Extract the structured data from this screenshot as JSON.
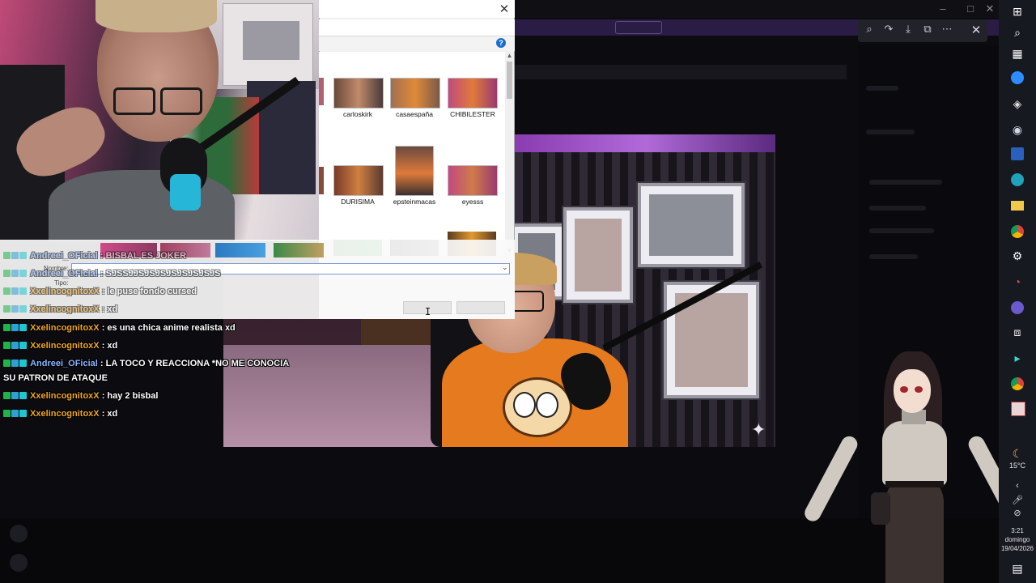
{
  "dialog": {
    "files": [
      {
        "name": ""
      },
      {
        "name": "carloskirk"
      },
      {
        "name": "casaespaña"
      },
      {
        "name": "CHIBILESTER"
      },
      {
        "name": ""
      },
      {
        "name": "DURISIMA"
      },
      {
        "name": "epsteinmacas"
      },
      {
        "name": "eyesss"
      }
    ],
    "name_label": "Nombre:",
    "type_label": "Tipo:",
    "name_value": "",
    "open_label": "",
    "cancel_label": ""
  },
  "chat": {
    "messages": [
      {
        "user": "Andreei_OFicial",
        "user_color": "#8ab4ff",
        "text": ": BISBAL ES JOKER",
        "badges": [
          "green",
          "blue",
          "cyan"
        ]
      },
      {
        "user": "Andreei_OFicial",
        "user_color": "#8ab4ff",
        "text": ": SJSSJJSJSJSJSJSJSJSJS",
        "badges": [
          "green",
          "blue",
          "cyan"
        ]
      },
      {
        "user": "XxelincognitoxX",
        "user_color": "#f0a61e",
        "text": ": le puse fondo cursed",
        "badges": [
          "green",
          "blue",
          "cyan"
        ]
      },
      {
        "user": "XxelincognitoxX",
        "user_color": "#f0a61e",
        "text": ": xd",
        "badges": [
          "green",
          "blue",
          "cyan"
        ]
      },
      {
        "user": "XxelincognitoxX",
        "user_color": "#f0a61e",
        "text": ": es una chica anime realista xd",
        "badges": [
          "green",
          "blue",
          "cyan"
        ]
      },
      {
        "user": "XxelincognitoxX",
        "user_color": "#f0a61e",
        "text": ": xd",
        "badges": [
          "green",
          "blue",
          "cyan"
        ]
      },
      {
        "user": "Andreei_OFicial",
        "user_color": "#8ab4ff",
        "text": ": LA TOCO Y REACCIONA *NO ME CONOCIA",
        "badges": [
          "green",
          "blue",
          "cyan"
        ]
      },
      {
        "user": "",
        "user_color": "#ffffff",
        "text": "SU PATRON DE ATAQUE",
        "badges": []
      },
      {
        "user": "XxelincognitoxX",
        "user_color": "#f0a61e",
        "text": ": hay 2 bisbal",
        "badges": [
          "green",
          "blue",
          "cyan"
        ]
      },
      {
        "user": "XxelincognitoxX",
        "user_color": "#f0a61e",
        "text": ": xd",
        "badges": [
          "green",
          "blue",
          "cyan"
        ]
      }
    ]
  },
  "taskbar": {
    "icons": [
      "windows-start",
      "search",
      "task-view",
      "zoom",
      "app",
      "steam",
      "word",
      "edge",
      "file-explorer",
      "chrome",
      "settings",
      "speed",
      "obs",
      "capcut",
      "terminal",
      "chrome-alt",
      "app-red"
    ],
    "weather_icon": "moon-icon",
    "temperature": "15°C",
    "time": "3:21",
    "day": "domingo",
    "date": "19/04/2026",
    "notification_icon": "chat-icon"
  },
  "colors": {
    "accent": "#1a6dd1",
    "chat_orange": "#f0a61e",
    "chat_blue": "#8ab4ff",
    "streamer_shirt": "#e57a1e",
    "foam_purple": "#b06ad8",
    "announce_bar": "#2a1c44"
  }
}
